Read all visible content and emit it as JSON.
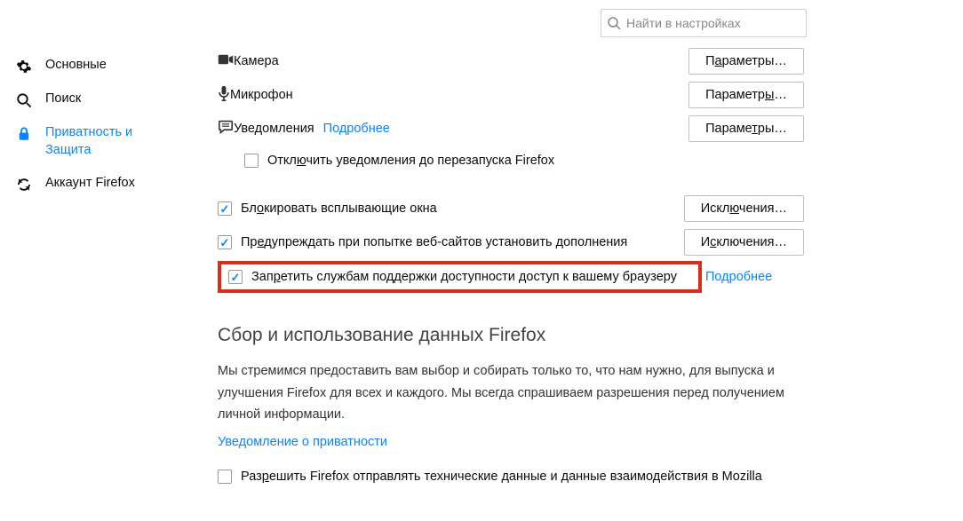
{
  "search": {
    "placeholder": "Найти в настройках"
  },
  "sidebar": {
    "items": [
      {
        "label": "Основные"
      },
      {
        "label": "Поиск"
      },
      {
        "label": "Приватность и Защита"
      },
      {
        "label": "Аккаунт Firefox"
      }
    ]
  },
  "permissions": {
    "camera": "Камера",
    "microphone": "Микрофон",
    "notifications": "Уведомления",
    "learn_more": "Подробнее",
    "btn_params_a": "Параметры…",
    "btn_params_y": "Параметры…",
    "btn_params_t": "Параметры…",
    "disable_notifications": "Отключить уведомления до перезапуска Firefox",
    "block_popups": "Блокировать всплывающие окна",
    "warn_addons": "Предупреждать при попытке веб-сайтов установить дополнения",
    "exceptions": "Исключения…",
    "exceptions2": "Исключения…",
    "a11y_block": "Запретить службам поддержки доступности доступ к вашему браузеру",
    "a11y_learn_more": "Подробнее"
  },
  "data_section": {
    "title": "Сбор и использование данных Firefox",
    "paragraph": "Мы стремимся предоставить вам выбор и собирать только то, что нам нужно, для выпуска и улучшения Firefox для всех и каждого. Мы всегда спрашиваем разрешения перед получением личной информации.",
    "privacy_notice": "Уведомление о приватности",
    "allow_tech_data": "Разрешить Firefox отправлять технические данные и данные взаимодействия в Mozilla"
  }
}
